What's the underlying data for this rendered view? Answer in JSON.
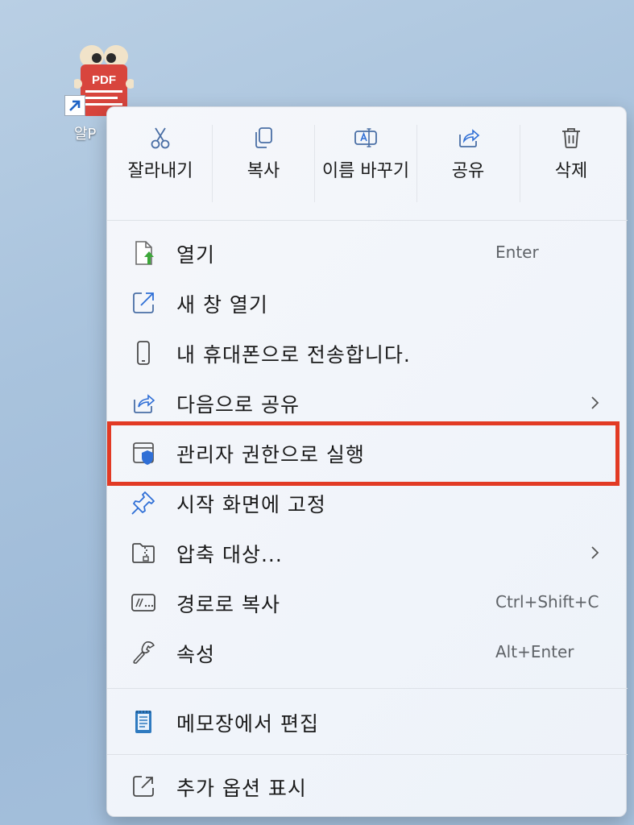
{
  "desktop": {
    "icon_label": "알P",
    "icon_badge": "PDF"
  },
  "quick_actions": [
    {
      "label": "잘라내기",
      "icon": "scissors-icon"
    },
    {
      "label": "복사",
      "icon": "copy-icon"
    },
    {
      "label": "이름 바꾸기",
      "icon": "rename-icon"
    },
    {
      "label": "공유",
      "icon": "share-icon"
    },
    {
      "label": "삭제",
      "icon": "trash-icon"
    }
  ],
  "menu_items": [
    {
      "label": "열기",
      "shortcut": "Enter",
      "icon": "open-file-icon"
    },
    {
      "label": "새 창 열기",
      "shortcut": "",
      "icon": "new-window-icon"
    },
    {
      "label": "내 휴대폰으로 전송합니다.",
      "shortcut": "",
      "icon": "phone-icon"
    },
    {
      "label": "다음으로 공유",
      "shortcut": "",
      "icon": "share-icon",
      "submenu": true
    },
    {
      "label": "관리자 권한으로 실행",
      "shortcut": "",
      "icon": "admin-shield-icon",
      "highlighted": true
    },
    {
      "label": "시작 화면에 고정",
      "shortcut": "",
      "icon": "pin-icon"
    },
    {
      "label": "압축 대상...",
      "shortcut": "",
      "icon": "zip-folder-icon",
      "submenu": true
    },
    {
      "label": "경로로 복사",
      "shortcut": "Ctrl+Shift+C",
      "icon": "copy-path-icon"
    },
    {
      "label": "속성",
      "shortcut": "Alt+Enter",
      "icon": "wrench-icon"
    }
  ],
  "notepad_item": {
    "label": "메모장에서 편집",
    "icon": "notepad-icon"
  },
  "more_item": {
    "label": "추가 옵션 표시",
    "icon": "more-options-icon"
  },
  "colors": {
    "highlight_border": "#e23a24",
    "accent": "#2f6fd6"
  }
}
